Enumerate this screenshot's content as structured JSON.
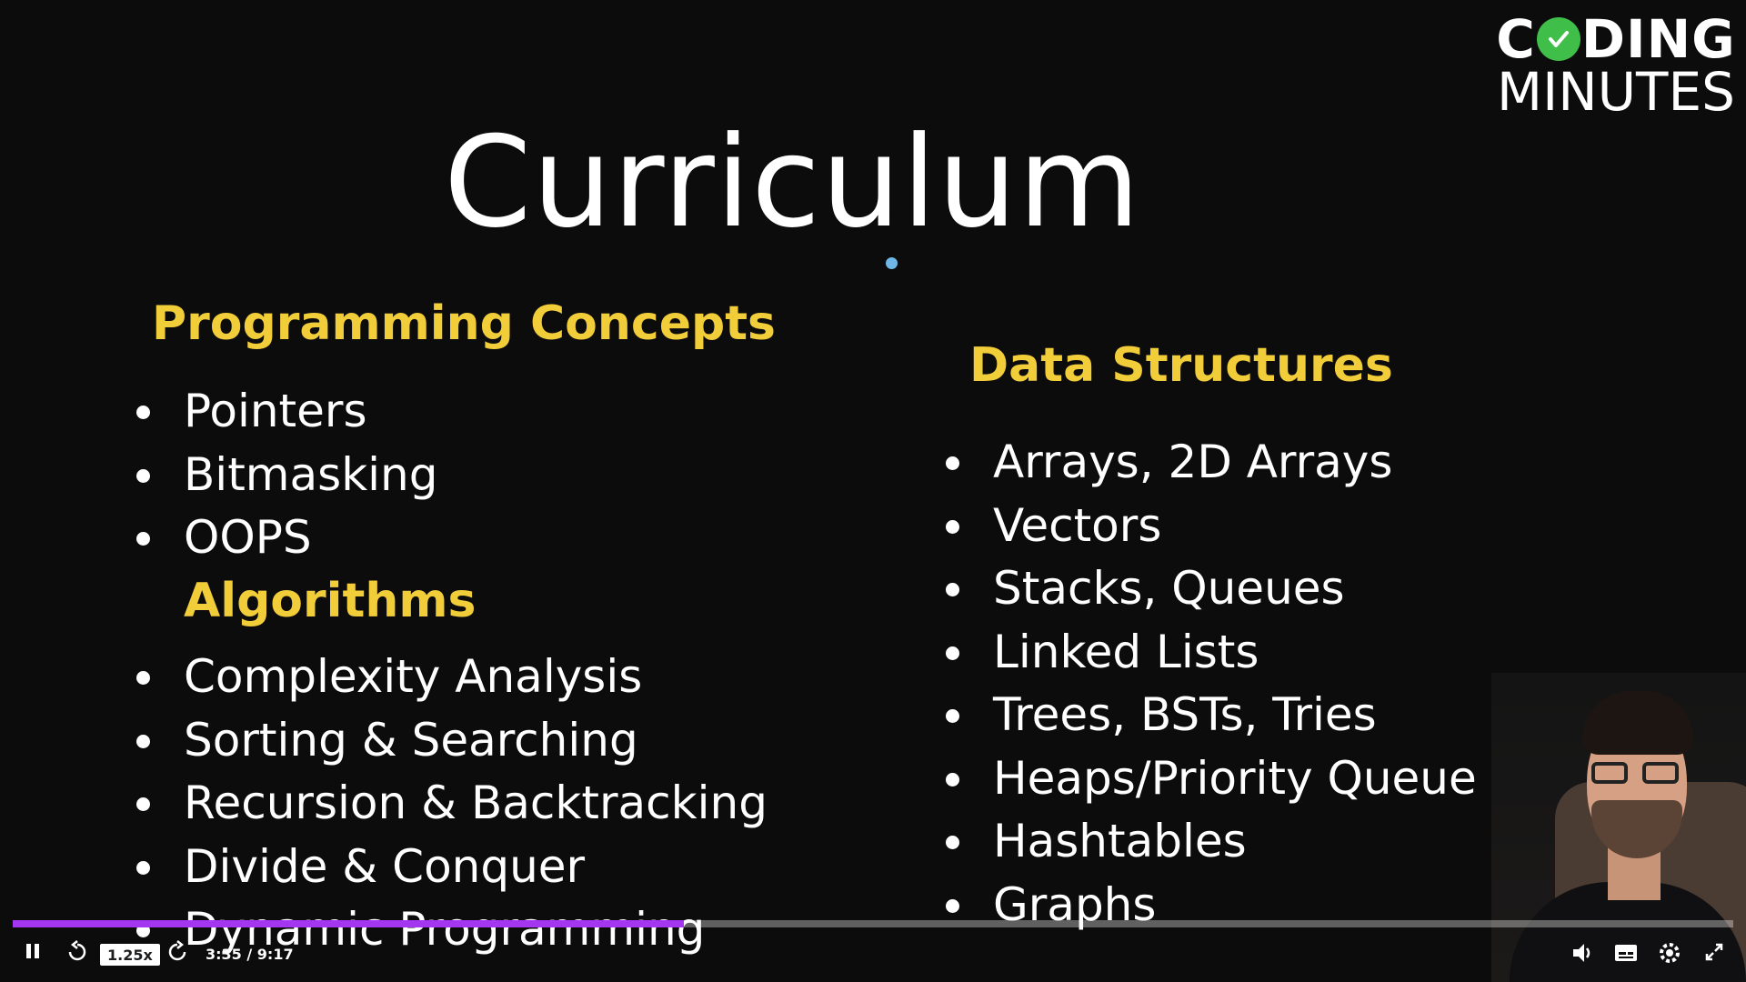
{
  "logo": {
    "line1_pre": "C",
    "line1_post": "DING",
    "line2": "MINUTES"
  },
  "title": "Curriculum",
  "programming_concepts": {
    "heading": "Programming Concepts",
    "items": [
      "Pointers",
      "Bitmasking",
      "OOPS"
    ]
  },
  "algorithms": {
    "heading": "Algorithms",
    "items": [
      "Complexity Analysis",
      "Sorting & Searching",
      "Recursion & Backtracking",
      "Divide & Conquer",
      "Dynamic Programming"
    ]
  },
  "data_structures": {
    "heading": "Data Structures",
    "items": [
      "Arrays, 2D Arrays",
      "Vectors",
      "Stacks, Queues",
      "Linked Lists",
      "Trees, BSTs, Tries",
      "Heaps/Priority Queue",
      "Hashtables",
      "Graphs"
    ]
  },
  "player": {
    "speed": "1.25x",
    "time": "3:35 / 9:17",
    "progress_fraction": 0.39,
    "accent_color": "#a435f0",
    "icons": [
      "pause-icon",
      "rewind-icon",
      "forward-icon",
      "volume-icon",
      "captions-icon",
      "settings-icon",
      "expand-icon"
    ]
  }
}
